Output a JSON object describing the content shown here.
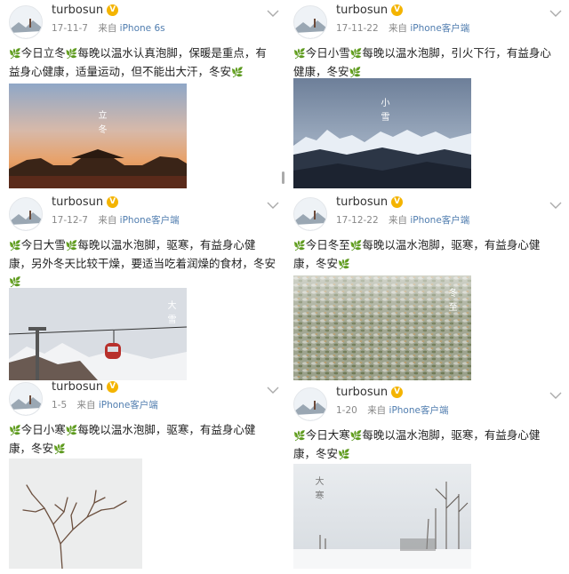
{
  "posts": [
    {
      "username": "turbosun",
      "badge": "V",
      "date": "17-11-7",
      "from_prefix": "来自",
      "source": "iPhone 6s",
      "text_segments": [
        "今日立冬",
        "每晚以温水认真泡脚，保暖是重点，有益身心健康，适量运动，但不能出大汗，冬安"
      ],
      "photo_label": "立冬"
    },
    {
      "username": "turbosun",
      "badge": "V",
      "date": "17-11-22",
      "from_prefix": "来自",
      "source": "iPhone客户端",
      "text_segments": [
        "今日小雪",
        "每晚以温水泡脚，引火下行，有益身心健康，冬安"
      ],
      "photo_label": "小雪"
    },
    {
      "username": "turbosun",
      "badge": "V",
      "date": "17-12-7",
      "from_prefix": "来自",
      "source": "iPhone客户端",
      "text_segments": [
        "今日大雪",
        "每晚以温水泡脚，驱寒，有益身心健康，另外冬天比较干燥，要适当吃着润燥的食材，冬安"
      ],
      "photo_label": "大雪"
    },
    {
      "username": "turbosun",
      "badge": "V",
      "date": "17-12-22",
      "from_prefix": "来自",
      "source": "iPhone客户端",
      "text_segments": [
        "今日冬至",
        "每晚以温水泡脚，驱寒，有益身心健康，冬安"
      ],
      "photo_label": "冬至"
    },
    {
      "username": "turbosun",
      "badge": "V",
      "date": "1-5",
      "from_prefix": "来自",
      "source": "iPhone客户端",
      "text_segments": [
        "今日小寒",
        "每晚以温水泡脚，驱寒，有益身心健康，冬安"
      ],
      "photo_label": ""
    },
    {
      "username": "turbosun",
      "badge": "V",
      "date": "1-20",
      "from_prefix": "来自",
      "source": "iPhone客户端",
      "text_segments": [
        "今日大寒",
        "每晚以温水泡脚，驱寒，有益身心健康，冬安"
      ],
      "photo_label": "大寒"
    }
  ],
  "icons": {
    "leaf": "leaf-emoji-icon",
    "menu": "chevron-down-icon",
    "avatar": "snow-landscape-avatar-icon"
  },
  "colors": {
    "source_link": "#507daf",
    "leaf_green": "#4a9c2e",
    "badge": "#f4b400"
  }
}
